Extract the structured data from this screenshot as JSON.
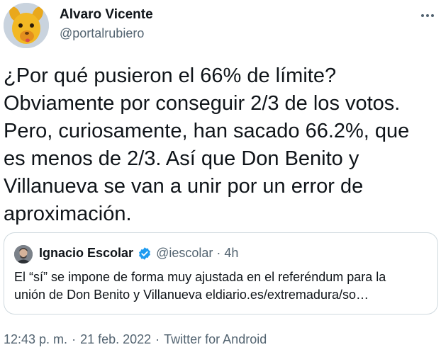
{
  "author": {
    "name": "Alvaro Vicente",
    "handle": "@portalrubiero"
  },
  "tweet": {
    "lines": [
      "¿Por qué pusieron el 66% de límite?",
      "Obviamente por conseguir 2/3 de los votos.",
      "Pero, curiosamente, han sacado 66.2%, que",
      "es menos de 2/3. Así que Don Benito y",
      "Villanueva se van a unir por un error de",
      "aproximación."
    ]
  },
  "quote": {
    "name": "Ignacio Escolar",
    "handle": "@iescolar",
    "separator": "·",
    "time": "4h",
    "lines": [
      "El “sí” se impone de forma muy ajustada en el referéndum para la",
      "unión de Don Benito y Villanueva eldiario.es/extremadura/so…"
    ],
    "verified_color": "#1d9bf0"
  },
  "meta": {
    "time": "12:43 p. m.",
    "separator": "·",
    "date": "21 feb. 2022",
    "source": "Twitter for Android"
  },
  "icons": {
    "more": "more-horizontal-icon",
    "verified": "verified-badge-icon"
  },
  "colors": {
    "text": "#0f1419",
    "secondary": "#536471",
    "border": "#cfd9de"
  }
}
